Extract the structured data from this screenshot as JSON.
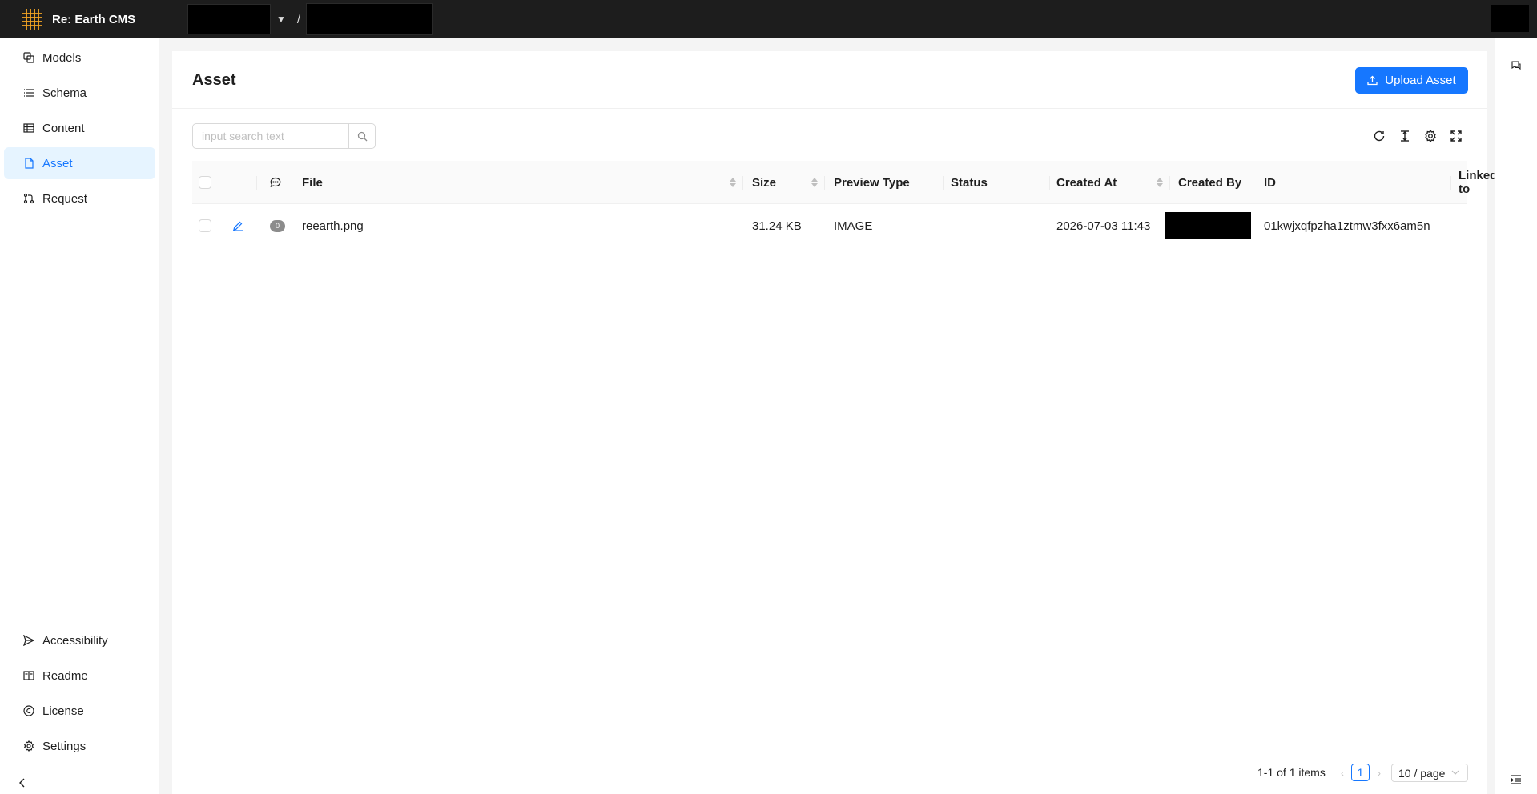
{
  "app": {
    "title": "Re: Earth CMS",
    "breadcrumb_separator": "/"
  },
  "sidebar": {
    "items": [
      {
        "label": "Models",
        "icon": "models-icon"
      },
      {
        "label": "Schema",
        "icon": "schema-icon"
      },
      {
        "label": "Content",
        "icon": "content-table-icon"
      },
      {
        "label": "Asset",
        "icon": "asset-file-icon",
        "active": true
      },
      {
        "label": "Request",
        "icon": "request-pull-icon"
      }
    ],
    "bottom_items": [
      {
        "label": "Accessibility",
        "icon": "send-icon"
      },
      {
        "label": "Readme",
        "icon": "book-icon"
      },
      {
        "label": "License",
        "icon": "copyright-icon"
      },
      {
        "label": "Settings",
        "icon": "gear-icon"
      }
    ]
  },
  "page": {
    "title": "Asset",
    "upload_label": "Upload Asset"
  },
  "search": {
    "placeholder": "input search text",
    "value": ""
  },
  "table": {
    "columns": {
      "file": "File",
      "size": "Size",
      "preview_type": "Preview Type",
      "status": "Status",
      "created_at": "Created At",
      "created_by": "Created By",
      "id": "ID",
      "linked_to": "Linked to"
    },
    "rows": [
      {
        "comments": "0",
        "file": "reearth.png",
        "size": "31.24 KB",
        "preview_type": "IMAGE",
        "status": "",
        "created_at": "2026-07-03 11:43",
        "id": "01kwjxqfpzha1ztmw3fxx6am5n",
        "linked_to": ""
      }
    ]
  },
  "pagination": {
    "total_text": "1-1 of 1 items",
    "current_page": "1",
    "page_size": "10 / page"
  },
  "colors": {
    "accent": "#1677ff",
    "header_bg": "#1d1d1d",
    "logo": "#f5a623"
  }
}
